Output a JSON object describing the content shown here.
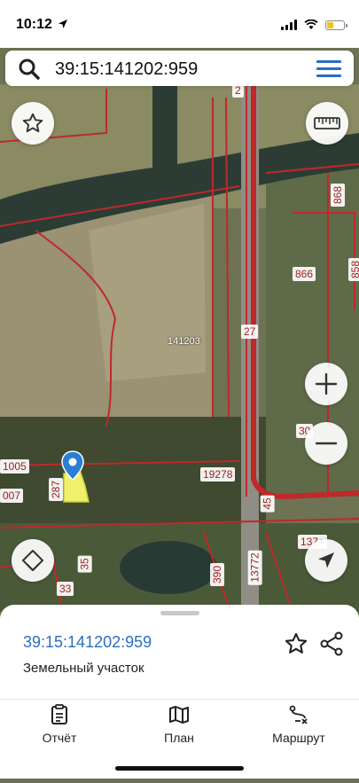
{
  "status_bar": {
    "time": "10:12"
  },
  "search": {
    "value": "39:15:141202:959"
  },
  "map_labels": {
    "block_141203": "141203",
    "label_868": "868",
    "label_858": "858",
    "label_866": "866",
    "label_27": "27",
    "label_30": "30",
    "label_19278": "19278",
    "label_1005": "1005",
    "label_007": "007",
    "label_287": "287",
    "label_45": "45",
    "label_1374": "137+",
    "label_35": "35",
    "label_33": "33",
    "label_390": "390",
    "label_13772": "13772",
    "label_2": "2"
  },
  "parcel": {
    "number": "39:15:141202:959",
    "type": "Земельный участок"
  },
  "tabs": {
    "report": "Отчёт",
    "plan": "План",
    "route": "Маршрут"
  },
  "colors": {
    "accent": "#2a6ec1",
    "boundary": "#c0282a",
    "parcel_fill": "#f1f06a"
  },
  "icons": [
    "search-icon",
    "menu-icon",
    "star-icon",
    "ruler-icon",
    "zoom-in-icon",
    "zoom-out-icon",
    "layers-icon",
    "navigation-arrow-icon",
    "location-pin-icon",
    "share-icon",
    "report-icon",
    "map-icon",
    "route-icon"
  ]
}
